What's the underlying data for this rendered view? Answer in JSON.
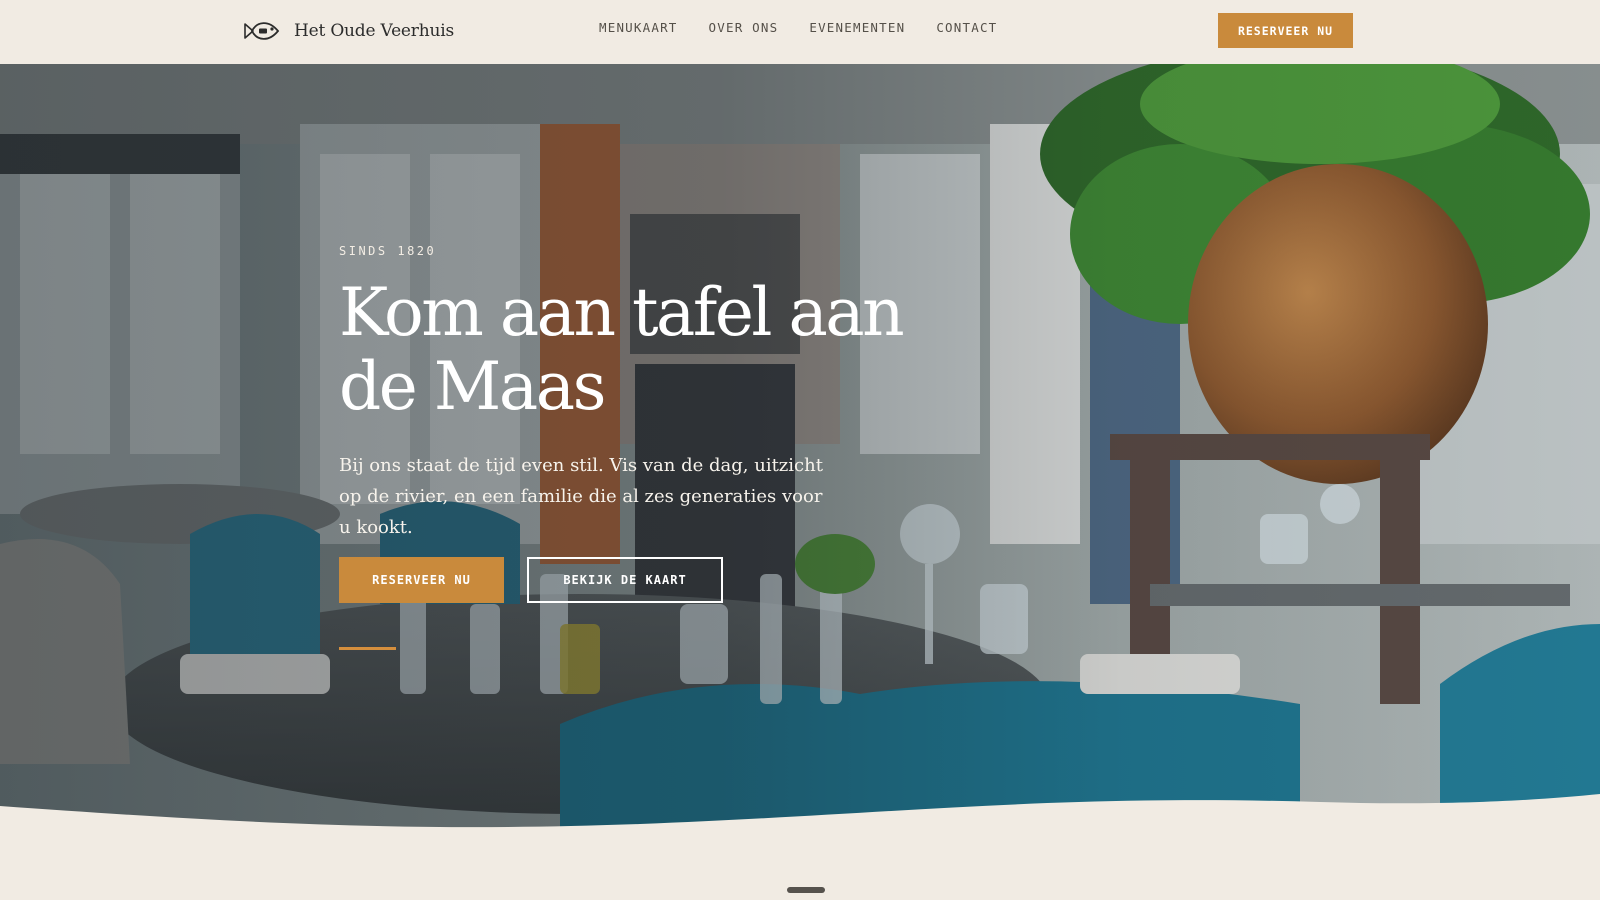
{
  "header": {
    "brand_name": "Het Oude Veerhuis",
    "logo_icon": "fish-logo-icon",
    "nav": [
      {
        "label": "MENUKAART"
      },
      {
        "label": "OVER ONS"
      },
      {
        "label": "EVENEMENTEN"
      },
      {
        "label": "CONTACT"
      }
    ],
    "cta_label": "RESERVEER NU"
  },
  "hero": {
    "eyebrow": "SINDS 1820",
    "title": "Kom aan tafel aan de Maas",
    "subtitle": "Bij ons staat de tijd even stil. Vis van de dag, uitzicht op de rivier, en een familie die al zes generaties voor u kookt.",
    "primary_button": "RESERVEER NU",
    "secondary_button": "BEKIJK DE KAART"
  },
  "colors": {
    "accent": "#c98a3c",
    "background": "#f1ebe3",
    "text_dark": "#2c2c2c"
  }
}
